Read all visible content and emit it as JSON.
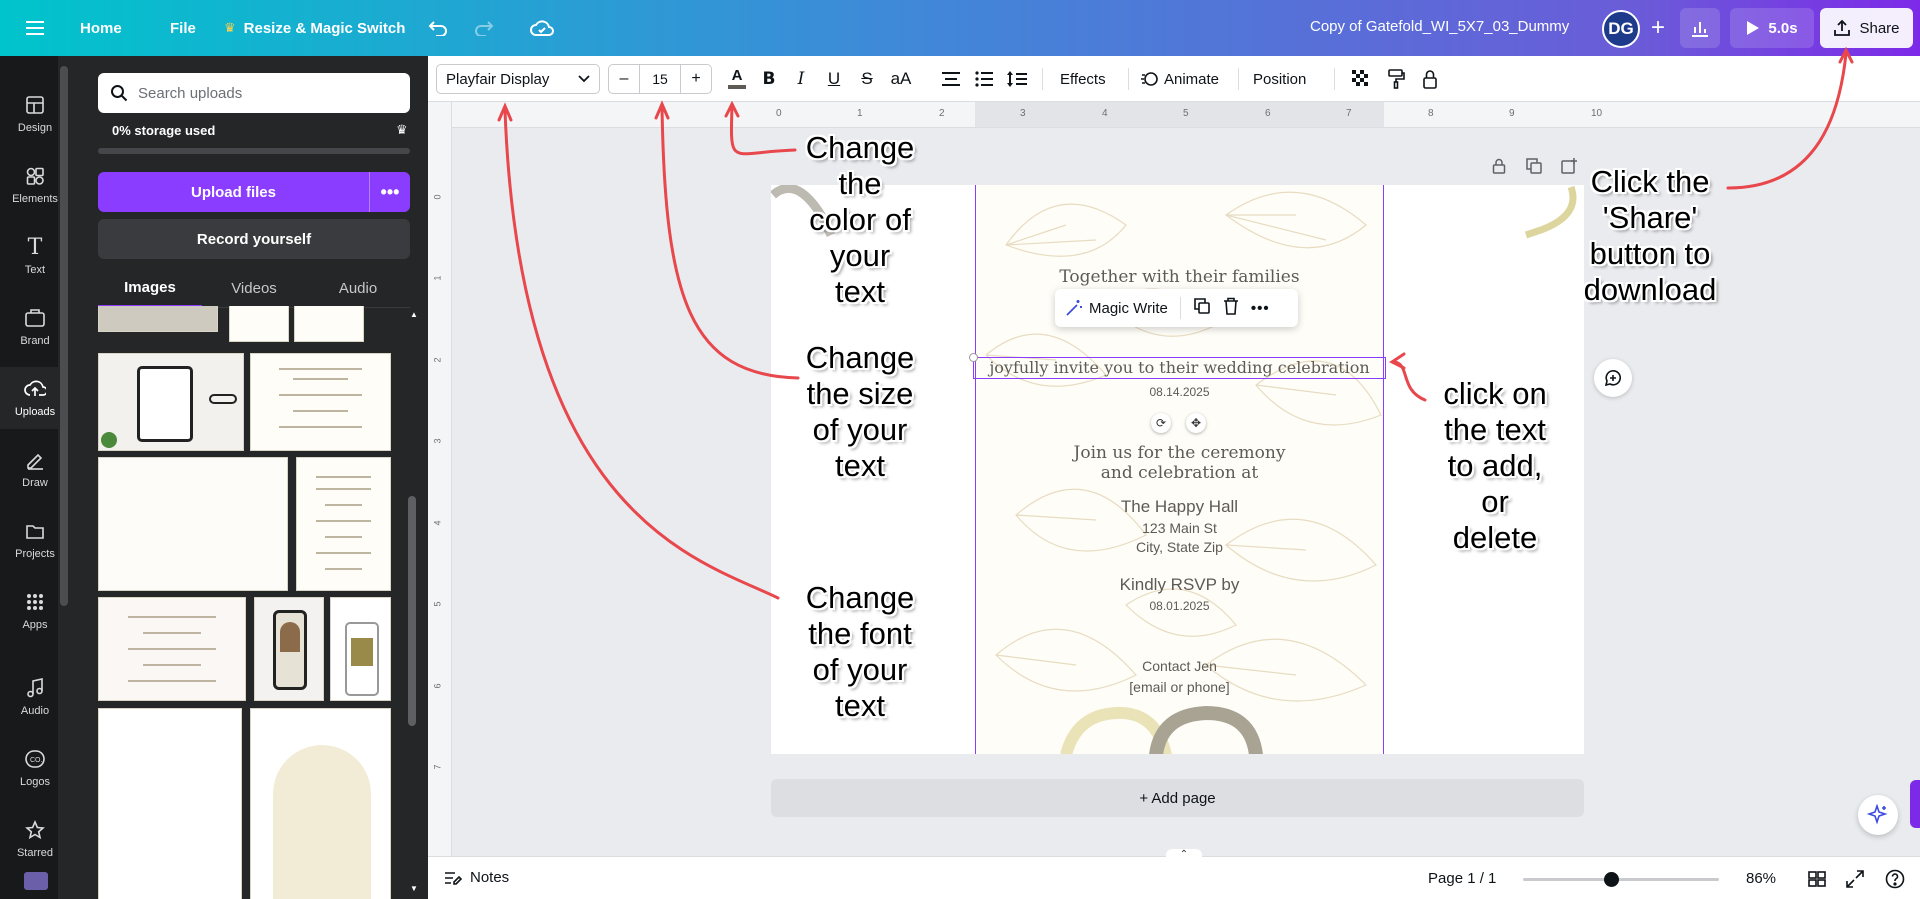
{
  "topbar": {
    "home": "Home",
    "file": "File",
    "resize": "Resize & Magic Switch",
    "doc_title": "Copy of Gatefold_WI_5X7_03_Dummy",
    "avatar_initials": "DG",
    "play_duration": "5.0s",
    "share": "Share"
  },
  "rail": [
    {
      "label": "Design",
      "icon": "design-icon"
    },
    {
      "label": "Elements",
      "icon": "elements-icon"
    },
    {
      "label": "Text",
      "icon": "text-icon"
    },
    {
      "label": "Brand",
      "icon": "brand-icon"
    },
    {
      "label": "Uploads",
      "icon": "upload-cloud-icon"
    },
    {
      "label": "Draw",
      "icon": "pen-icon"
    },
    {
      "label": "Projects",
      "icon": "folder-icon"
    },
    {
      "label": "Apps",
      "icon": "apps-grid-icon"
    },
    {
      "label": "Audio",
      "icon": "music-icon"
    },
    {
      "label": "Logos",
      "icon": "logo-icon"
    },
    {
      "label": "Starred",
      "icon": "star-icon"
    }
  ],
  "uploads": {
    "search_placeholder": "Search uploads",
    "storage": "0% storage used",
    "storage_fraction": 0,
    "upload_button": "Upload files",
    "record_button": "Record yourself",
    "tabs": [
      "Images",
      "Videos",
      "Audio"
    ]
  },
  "toolbar": {
    "font": "Playfair Display",
    "size_minus": "–",
    "font_size": "15",
    "size_plus": "+",
    "text_color_letter": "A",
    "case_label": "aA",
    "effects": "Effects",
    "animate": "Animate",
    "position": "Position"
  },
  "rulers": {
    "top": [
      "0",
      "1",
      "2",
      "3",
      "4",
      "5",
      "6",
      "7",
      "8",
      "9",
      "10"
    ],
    "left": [
      "0",
      "1",
      "2",
      "3",
      "4",
      "5",
      "6",
      "7"
    ]
  },
  "invitation": {
    "families": "Together with their families",
    "invite": "joyfully invite you to their wedding celebration",
    "date": "08.14.2025",
    "join_1": "Join us for the ceremony",
    "join_2": "and celebration at",
    "venue": "The Happy Hall",
    "street": "123 Main St",
    "city": "City, State Zip",
    "rsvp": "Kindly RSVP by",
    "rsvp_date": "08.01.2025",
    "contact": "Contact Jen",
    "contact_detail": "[email or phone]"
  },
  "context_menu": {
    "magic_write": "Magic Write"
  },
  "add_page": "+ Add page",
  "bottom": {
    "notes": "Notes",
    "page_indicator": "Page 1 / 1",
    "zoom": "86%",
    "zoom_fraction": 0.45
  },
  "annotations": {
    "font": "Change\nthe font\nof your\ntext",
    "size": "Change\nthe size\nof your\ntext",
    "color": "Change\nthe\ncolor of\nyour\ntext",
    "share": "Click the\n'Share'\nbutton to\ndownload",
    "click_text": "click on\nthe text\nto add,\nor\ndelete"
  },
  "colors": {
    "accent": "#8b3dff",
    "annotation_arrow": "#e8474c",
    "text_dark": "#0e1318"
  }
}
